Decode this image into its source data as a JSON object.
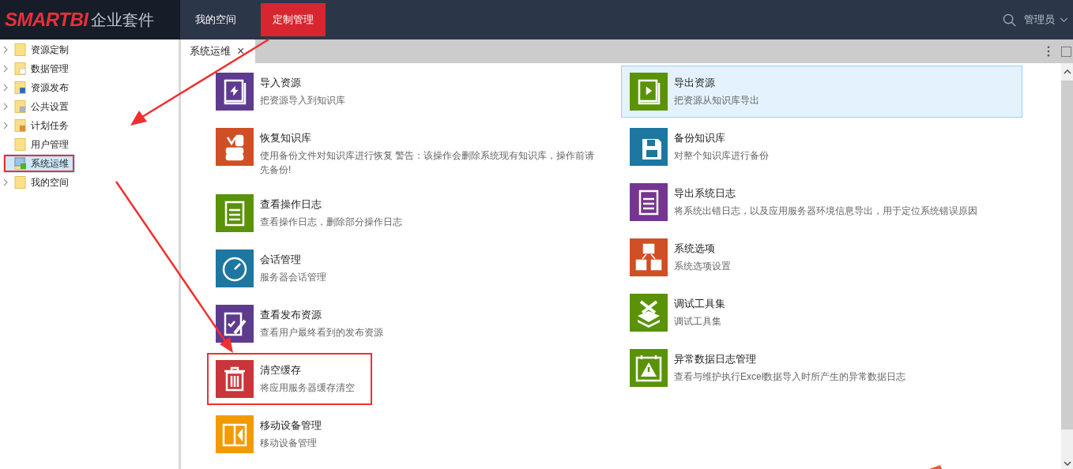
{
  "header": {
    "logo_brand": "SMARTBI",
    "logo_suffix": "企业套件",
    "nav": [
      {
        "label": "我的空间",
        "selected": false
      },
      {
        "label": "定制管理",
        "selected": true
      }
    ],
    "user": "管理员"
  },
  "sidebar": {
    "items": [
      {
        "label": "资源定制",
        "expandable": true,
        "selected": false,
        "highlighted": false
      },
      {
        "label": "数据管理",
        "expandable": true,
        "selected": false,
        "highlighted": false
      },
      {
        "label": "资源发布",
        "expandable": true,
        "selected": false,
        "highlighted": false
      },
      {
        "label": "公共设置",
        "expandable": true,
        "selected": false,
        "highlighted": false
      },
      {
        "label": "计划任务",
        "expandable": true,
        "selected": false,
        "highlighted": false
      },
      {
        "label": "用户管理",
        "expandable": false,
        "selected": false,
        "highlighted": false
      },
      {
        "label": "系统运维",
        "expandable": false,
        "selected": true,
        "highlighted": true
      },
      {
        "label": "我的空间",
        "expandable": true,
        "selected": false,
        "highlighted": false
      }
    ]
  },
  "tabs": [
    {
      "label": "系统运维",
      "selected": true,
      "close": "×"
    }
  ],
  "left_column": [
    {
      "title": "导入资源",
      "description": "把资源导入到知识库",
      "color": "#5e3b8f",
      "selected": false,
      "highlighted": false
    },
    {
      "title": "恢复知识库",
      "description": "使用备份文件对知识库进行恢复 警告：该操作会删除系统现有知识库，操作前请先备份!",
      "color": "#d04f24",
      "selected": false,
      "highlighted": false
    },
    {
      "title": "查看操作日志",
      "description": "查看操作日志，删除部分操作日志",
      "color": "#5a9208",
      "selected": false,
      "highlighted": false
    },
    {
      "title": "会话管理",
      "description": "服务器会话管理",
      "color": "#1d77a0",
      "selected": false,
      "highlighted": false
    },
    {
      "title": "查看发布资源",
      "description": "查看用户最终看到的发布资源",
      "color": "#5e3b8f",
      "selected": false,
      "highlighted": false
    },
    {
      "title": "清空缓存",
      "description": "将应用服务器缓存清空",
      "color": "#c9353a",
      "selected": false,
      "highlighted": true
    },
    {
      "title": "移动设备管理",
      "description": "移动设备管理",
      "color": "#f29b00",
      "selected": false,
      "highlighted": false
    }
  ],
  "right_column": [
    {
      "title": "导出资源",
      "description": "把资源从知识库导出",
      "color": "#5a9208",
      "selected": true,
      "highlighted": false
    },
    {
      "title": "备份知识库",
      "description": "对整个知识库进行备份",
      "color": "#1d77a0",
      "selected": false,
      "highlighted": false
    },
    {
      "title": "导出系统日志",
      "description": "将系统出错日志，以及应用服务器环境信息导出，用于定位系统错误原因",
      "color": "#76358f",
      "selected": false,
      "highlighted": false
    },
    {
      "title": "系统选项",
      "description": "系统选项设置",
      "color": "#d04f24",
      "selected": false,
      "highlighted": false
    },
    {
      "title": "调试工具集",
      "description": "调试工具集",
      "color": "#5a9208",
      "selected": false,
      "highlighted": false
    },
    {
      "title": "异常数据日志管理",
      "description": "查看与维护执行Excel数据导入时所产生的异常数据日志",
      "color": "#5a9208",
      "selected": false,
      "highlighted": false
    }
  ]
}
